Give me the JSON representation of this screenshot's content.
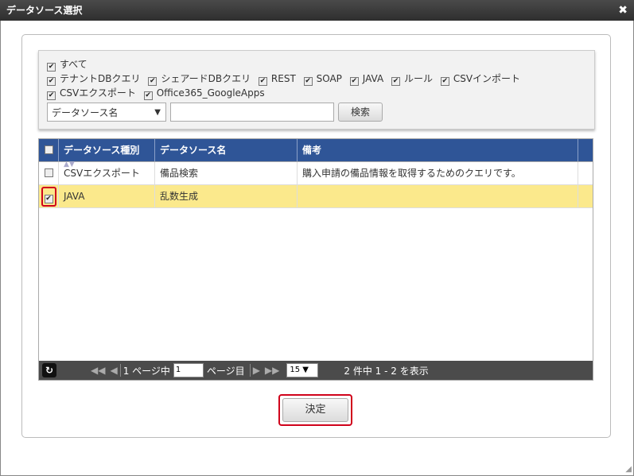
{
  "dialog": {
    "title": "データソース選択",
    "close": "✖"
  },
  "filters": {
    "all": "すべて",
    "types": [
      "テナントDBクエリ",
      "シェアードDBクエリ",
      "REST",
      "SOAP",
      "JAVA",
      "ルール",
      "CSVインポート",
      "CSVエクスポート",
      "Office365_GoogleApps"
    ]
  },
  "search": {
    "field_select": "データソース名",
    "query": "",
    "button": "検索"
  },
  "grid": {
    "headers": [
      "データソース種別",
      "データソース名",
      "備考"
    ],
    "rows": [
      {
        "type": "CSVエクスポート",
        "name": "備品検索",
        "note": "購入申請の備品情報を取得するためのクエリです。",
        "checked": false
      },
      {
        "type": "JAVA",
        "name": "乱数生成",
        "note": "",
        "checked": true
      }
    ]
  },
  "pager": {
    "page_label_pre": "1 ページ中",
    "page": "1",
    "page_label_post": "ページ目",
    "page_size": "15",
    "summary": "2 件中 1 - 2 を表示"
  },
  "footer": {
    "decide": "決定"
  }
}
